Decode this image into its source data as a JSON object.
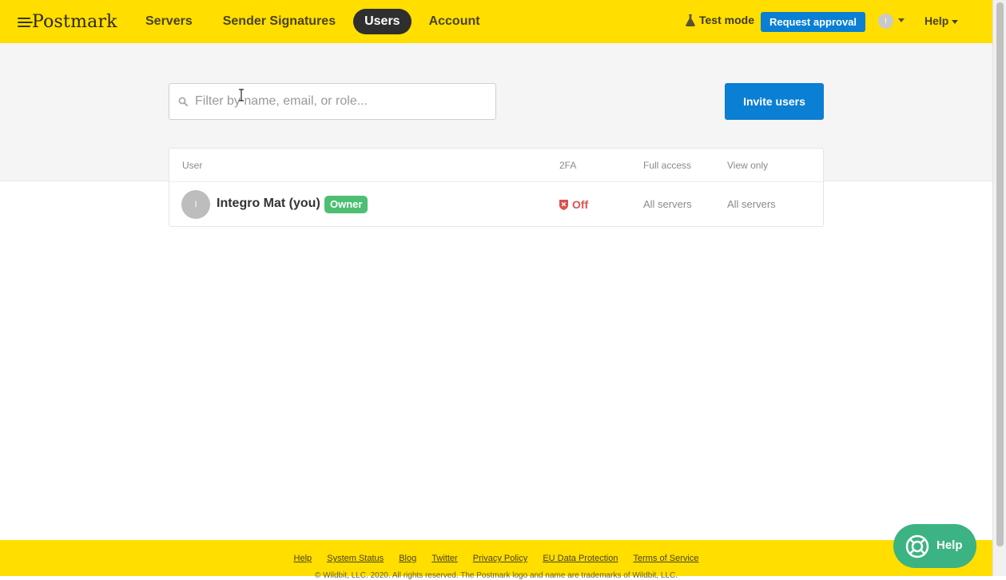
{
  "brand": {
    "name": "Postmark"
  },
  "nav": {
    "items": [
      {
        "label": "Servers",
        "active": false
      },
      {
        "label": "Sender Signatures",
        "active": false
      },
      {
        "label": "Users",
        "active": true
      },
      {
        "label": "Account",
        "active": false
      }
    ]
  },
  "header": {
    "test_mode": "Test mode",
    "request_approval": "Request approval",
    "avatar_initial": "I",
    "help": "Help"
  },
  "search": {
    "placeholder": "Filter by name, email, or role..."
  },
  "invite_button": "Invite users",
  "table": {
    "headers": {
      "user": "User",
      "tfa": "2FA",
      "full_access": "Full access",
      "view_only": "View only"
    },
    "rows": [
      {
        "initial": "I",
        "name": "Integro Mat (you)",
        "badge": "Owner",
        "tfa": "Off",
        "full_access": "All servers",
        "view_only": "All servers"
      }
    ]
  },
  "footer": {
    "links": [
      "Help",
      "System Status",
      "Blog",
      "Twitter",
      "Privacy Policy",
      "EU Data Protection",
      "Terms of Service"
    ],
    "copyright": "© Wildbit, LLC. 2020. All rights reserved. The Postmark logo and name are trademarks of Wildbit, LLC."
  },
  "help_widget": {
    "label": "Help"
  },
  "colors": {
    "brand_yellow": "#ffde00",
    "primary_blue": "#0a7fd3",
    "owner_green": "#4cbf73",
    "danger_red": "#d9534f",
    "help_green": "#3cb382"
  }
}
